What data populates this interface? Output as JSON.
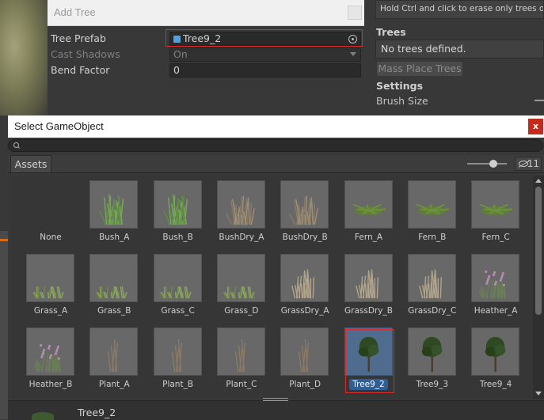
{
  "add_tree": {
    "title": "Add Tree",
    "properties": [
      {
        "label": "Tree Prefab",
        "value": "Tree9_2",
        "enabled": true
      },
      {
        "label": "Cast Shadows",
        "value": "On",
        "enabled": false
      },
      {
        "label": "Bend Factor",
        "value": "0",
        "enabled": true
      }
    ]
  },
  "inspector": {
    "hint": "Hold Ctrl and click to erase only trees of the",
    "trees_header": "Trees",
    "no_trees": "No trees defined.",
    "mass_place_button": "Mass Place Trees",
    "settings_header": "Settings",
    "brush_size_label": "Brush Size"
  },
  "picker": {
    "title": "Select GameObject",
    "close_label": "x",
    "search_placeholder": "",
    "tabs": [
      "Assets"
    ],
    "hidden_count": "11",
    "items": [
      {
        "name": "None",
        "kind": "none"
      },
      {
        "name": "Bush_A",
        "kind": "bush"
      },
      {
        "name": "Bush_B",
        "kind": "bush"
      },
      {
        "name": "BushDry_A",
        "kind": "dry"
      },
      {
        "name": "BushDry_B",
        "kind": "dry"
      },
      {
        "name": "Fern_A",
        "kind": "fern"
      },
      {
        "name": "Fern_B",
        "kind": "fern"
      },
      {
        "name": "Fern_C",
        "kind": "fern"
      },
      {
        "name": "Grass_A",
        "kind": "grass"
      },
      {
        "name": "Grass_B",
        "kind": "grass"
      },
      {
        "name": "Grass_C",
        "kind": "grass"
      },
      {
        "name": "Grass_D",
        "kind": "grass"
      },
      {
        "name": "GrassDry_A",
        "kind": "grassdry"
      },
      {
        "name": "GrassDry_B",
        "kind": "grassdry"
      },
      {
        "name": "GrassDry_C",
        "kind": "grassdry"
      },
      {
        "name": "Heather_A",
        "kind": "heather"
      },
      {
        "name": "Heather_B",
        "kind": "heather"
      },
      {
        "name": "Plant_A",
        "kind": "plant"
      },
      {
        "name": "Plant_B",
        "kind": "plant"
      },
      {
        "name": "Plant_C",
        "kind": "plant"
      },
      {
        "name": "Plant_D",
        "kind": "plant"
      },
      {
        "name": "Tree9_2",
        "kind": "tree",
        "selected": true
      },
      {
        "name": "Tree9_3",
        "kind": "tree"
      },
      {
        "name": "Tree9_4",
        "kind": "tree"
      }
    ],
    "selected_name": "Tree9_2"
  },
  "colors": {
    "selection": "#2d5f96",
    "highlight_frame": "#d82b2b",
    "close_button": "#c42b1c",
    "prefab_icon": "#4aa3e0"
  }
}
